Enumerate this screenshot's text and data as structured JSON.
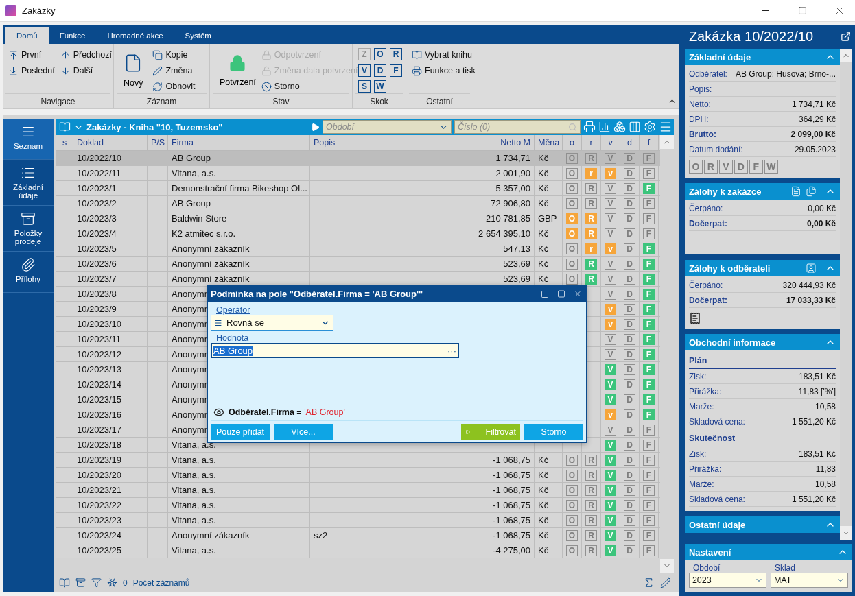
{
  "window": {
    "title": "Zakázky"
  },
  "ribbon": {
    "tabs": [
      {
        "label": "Domů",
        "selected": true
      },
      {
        "label": "Funkce",
        "selected": false
      },
      {
        "label": "Hromadné akce",
        "selected": false
      },
      {
        "label": "Systém",
        "selected": false
      }
    ],
    "navigace": {
      "label": "Navigace",
      "items": [
        {
          "label": "První"
        },
        {
          "label": "Poslední"
        },
        {
          "label": "Předchozí"
        },
        {
          "label": "Další"
        }
      ]
    },
    "zaznam": {
      "label": "Záznam",
      "big": "Nový",
      "items": [
        {
          "label": "Kopie"
        },
        {
          "label": "Změna"
        },
        {
          "label": "Obnovit"
        }
      ]
    },
    "stav": {
      "label": "Stav",
      "big": "Potvrzení",
      "items": [
        {
          "label": "Odpotvrzení",
          "disabled": true
        },
        {
          "label": "Změna data potvrzení",
          "disabled": true
        },
        {
          "label": "Storno",
          "disabled": false
        }
      ]
    },
    "skok": {
      "label": "Skok",
      "keys": [
        {
          "label": "Z",
          "disabled": true
        },
        {
          "label": "O",
          "disabled": false
        },
        {
          "label": "R",
          "disabled": false
        },
        {
          "label": "V",
          "disabled": false
        },
        {
          "label": "D",
          "disabled": false
        },
        {
          "label": "F",
          "disabled": false
        },
        {
          "label": "S",
          "disabled": false
        },
        {
          "label": "W",
          "disabled": false
        }
      ]
    },
    "ostatni": {
      "label": "Ostatní",
      "items": [
        {
          "label": "Vybrat knihu"
        },
        {
          "label": "Funkce a tisk"
        }
      ]
    }
  },
  "nav": [
    {
      "label": "Seznam",
      "selected": true
    },
    {
      "label": "Základní údaje",
      "selected": false
    },
    {
      "label": "Položky prodeje",
      "selected": false
    },
    {
      "label": "Přílohy",
      "selected": false
    }
  ],
  "grid": {
    "title": "Zakázky - Kniha \"10, Tuzemsko\"",
    "period_placeholder": "Období",
    "number_placeholder": "Číslo (0)",
    "columns": [
      "s",
      "Doklad",
      "P/S",
      "Firma",
      "Popis",
      "Netto M",
      "Měna",
      "o",
      "r",
      "v",
      "d",
      "f"
    ],
    "rows": [
      {
        "selected": true,
        "doklad": "10/2022/10",
        "firma": "AB Group",
        "netto": "1 734,71",
        "mena": "Kč",
        "flags": {
          "o": {
            "letter": "O",
            "lit": false
          },
          "r": {
            "letter": "R",
            "lit": false
          },
          "v": {
            "letter": "V",
            "lit": false
          },
          "d": {
            "letter": "D",
            "lit": false
          },
          "f": {
            "letter": "F",
            "lit": false
          }
        }
      },
      {
        "selected": false,
        "doklad": "10/2022/11",
        "firma": "Vitana, a.s.",
        "netto": "2 001,90",
        "mena": "Kč",
        "flags": {
          "o": {
            "letter": "O",
            "lit": false
          },
          "r": {
            "letter": "r",
            "lit": true,
            "color": "#f6a53a"
          },
          "v": {
            "letter": "v",
            "lit": true,
            "color": "#f6a53a"
          },
          "d": {
            "letter": "D",
            "lit": false
          },
          "f": {
            "letter": "F",
            "lit": false
          }
        }
      },
      {
        "selected": false,
        "doklad": "10/2023/1",
        "firma": "Demonstrační firma Bikeshop Ol...",
        "netto": "5 357,00",
        "mena": "Kč",
        "flags": {
          "o": {
            "letter": "O",
            "lit": false
          },
          "r": {
            "letter": "R",
            "lit": false
          },
          "v": {
            "letter": "V",
            "lit": false
          },
          "d": {
            "letter": "D",
            "lit": false
          },
          "f": {
            "letter": "F",
            "lit": true,
            "color": "#3cc47c"
          }
        }
      },
      {
        "selected": false,
        "doklad": "10/2023/2",
        "firma": "AB Group",
        "netto": "72 906,80",
        "mena": "Kč",
        "flags": {
          "o": {
            "letter": "O",
            "lit": false
          },
          "r": {
            "letter": "R",
            "lit": false
          },
          "v": {
            "letter": "V",
            "lit": false
          },
          "d": {
            "letter": "D",
            "lit": false
          },
          "f": {
            "letter": "F",
            "lit": false
          }
        }
      },
      {
        "selected": false,
        "doklad": "10/2023/3",
        "firma": "Baldwin Store",
        "netto": "210 781,85",
        "mena": "GBP",
        "flags": {
          "o": {
            "letter": "O",
            "lit": true,
            "color": "#f6a53a"
          },
          "r": {
            "letter": "R",
            "lit": true,
            "color": "#f6a53a"
          },
          "v": {
            "letter": "V",
            "lit": false
          },
          "d": {
            "letter": "D",
            "lit": false
          },
          "f": {
            "letter": "F",
            "lit": false
          }
        }
      },
      {
        "selected": false,
        "doklad": "10/2023/4",
        "firma": "K2 atmitec s.r.o.",
        "netto": "2 654 395,10",
        "mena": "Kč",
        "flags": {
          "o": {
            "letter": "O",
            "lit": true,
            "color": "#f6a53a"
          },
          "r": {
            "letter": "R",
            "lit": true,
            "color": "#f6a53a"
          },
          "v": {
            "letter": "V",
            "lit": false
          },
          "d": {
            "letter": "D",
            "lit": false
          },
          "f": {
            "letter": "F",
            "lit": false
          }
        }
      },
      {
        "selected": false,
        "doklad": "10/2023/5",
        "firma": "Anonymní zákazník",
        "netto": "547,13",
        "mena": "Kč",
        "flags": {
          "o": {
            "letter": "O",
            "lit": false
          },
          "r": {
            "letter": "r",
            "lit": true,
            "color": "#f6a53a"
          },
          "v": {
            "letter": "v",
            "lit": true,
            "color": "#f6a53a"
          },
          "d": {
            "letter": "D",
            "lit": false
          },
          "f": {
            "letter": "F",
            "lit": true,
            "color": "#3cc47c"
          }
        }
      },
      {
        "selected": false,
        "doklad": "10/2023/6",
        "firma": "Anonymní zákazník",
        "netto": "523,69",
        "mena": "Kč",
        "flags": {
          "o": {
            "letter": "O",
            "lit": false
          },
          "r": {
            "letter": "R",
            "lit": true,
            "color": "#3cc47c"
          },
          "v": {
            "letter": "V",
            "lit": false
          },
          "d": {
            "letter": "D",
            "lit": false
          },
          "f": {
            "letter": "F",
            "lit": true,
            "color": "#3cc47c"
          }
        }
      },
      {
        "selected": false,
        "doklad": "10/2023/7",
        "firma": "Anonymní zákazník",
        "netto": "523,69",
        "mena": "Kč",
        "flags": {
          "o": {
            "letter": "O",
            "lit": false
          },
          "r": {
            "letter": "R",
            "lit": true,
            "color": "#3cc47c"
          },
          "v": {
            "letter": "V",
            "lit": false
          },
          "d": {
            "letter": "D",
            "lit": false
          },
          "f": {
            "letter": "F",
            "lit": true,
            "color": "#3cc47c"
          }
        }
      },
      {
        "selected": false,
        "doklad": "10/2023/8",
        "firma": "Anonymn",
        "flags": {
          "v": {
            "letter": "V",
            "lit": false
          },
          "d": {
            "letter": "D",
            "lit": false
          },
          "f": {
            "letter": "F",
            "lit": true,
            "color": "#3cc47c"
          }
        }
      },
      {
        "selected": false,
        "doklad": "10/2023/9",
        "firma": "Anonymn",
        "flags": {
          "v": {
            "letter": "v",
            "lit": true,
            "color": "#f6a53a"
          },
          "d": {
            "letter": "D",
            "lit": false
          },
          "f": {
            "letter": "F",
            "lit": true,
            "color": "#3cc47c"
          }
        }
      },
      {
        "selected": false,
        "doklad": "10/2023/10",
        "firma": "Anonymn",
        "flags": {
          "v": {
            "letter": "v",
            "lit": true,
            "color": "#f6a53a"
          },
          "d": {
            "letter": "D",
            "lit": false
          },
          "f": {
            "letter": "F",
            "lit": true,
            "color": "#3cc47c"
          }
        }
      },
      {
        "selected": false,
        "doklad": "10/2023/11",
        "firma": "Anonymn",
        "flags": {
          "v": {
            "letter": "V",
            "lit": false
          },
          "d": {
            "letter": "D",
            "lit": false
          },
          "f": {
            "letter": "F",
            "lit": true,
            "color": "#3cc47c"
          }
        }
      },
      {
        "selected": false,
        "doklad": "10/2023/12",
        "firma": "Anonymn",
        "flags": {
          "v": {
            "letter": "V",
            "lit": false
          },
          "d": {
            "letter": "D",
            "lit": false
          },
          "f": {
            "letter": "F",
            "lit": true,
            "color": "#3cc47c"
          }
        }
      },
      {
        "selected": false,
        "doklad": "10/2023/13",
        "firma": "Anonymn",
        "flags": {
          "v": {
            "letter": "V",
            "lit": true,
            "color": "#3cc47c"
          },
          "d": {
            "letter": "D",
            "lit": false
          },
          "f": {
            "letter": "F",
            "lit": true,
            "color": "#3cc47c"
          }
        }
      },
      {
        "selected": false,
        "doklad": "10/2023/14",
        "firma": "Anonymn",
        "flags": {
          "v": {
            "letter": "V",
            "lit": true,
            "color": "#3cc47c"
          },
          "d": {
            "letter": "D",
            "lit": false
          },
          "f": {
            "letter": "F",
            "lit": true,
            "color": "#3cc47c"
          }
        }
      },
      {
        "selected": false,
        "doklad": "10/2023/15",
        "firma": "Anonymn",
        "flags": {
          "v": {
            "letter": "V",
            "lit": true,
            "color": "#3cc47c"
          },
          "d": {
            "letter": "D",
            "lit": false
          },
          "f": {
            "letter": "F",
            "lit": true,
            "color": "#3cc47c"
          }
        }
      },
      {
        "selected": false,
        "doklad": "10/2023/16",
        "firma": "Anonymn",
        "flags": {
          "v": {
            "letter": "v",
            "lit": true,
            "color": "#f6a53a"
          },
          "d": {
            "letter": "D",
            "lit": false
          },
          "f": {
            "letter": "F",
            "lit": true,
            "color": "#3cc47c"
          }
        }
      },
      {
        "selected": false,
        "doklad": "10/2023/17",
        "firma": "Anonymn",
        "flags": {
          "v": {
            "letter": "V",
            "lit": false
          },
          "d": {
            "letter": "D",
            "lit": false
          },
          "f": {
            "letter": "F",
            "lit": false
          }
        }
      },
      {
        "selected": false,
        "doklad": "10/2023/18",
        "firma": "Vitana, a.s.",
        "flags": {
          "v": {
            "letter": "V",
            "lit": true,
            "color": "#3cc47c"
          },
          "d": {
            "letter": "D",
            "lit": false
          },
          "f": {
            "letter": "F",
            "lit": false
          }
        }
      },
      {
        "selected": false,
        "doklad": "10/2023/19",
        "firma": "Vitana, a.s.",
        "netto": "-1 068,75",
        "mena": "Kč",
        "flags": {
          "o": {
            "letter": "O",
            "lit": false
          },
          "r": {
            "letter": "R",
            "lit": false
          },
          "v": {
            "letter": "V",
            "lit": true,
            "color": "#3cc47c"
          },
          "d": {
            "letter": "D",
            "lit": false
          },
          "f": {
            "letter": "F",
            "lit": false
          }
        }
      },
      {
        "selected": false,
        "doklad": "10/2023/20",
        "firma": "Vitana, a.s.",
        "netto": "-1 068,75",
        "mena": "Kč",
        "flags": {
          "o": {
            "letter": "O",
            "lit": false
          },
          "r": {
            "letter": "R",
            "lit": false
          },
          "v": {
            "letter": "V",
            "lit": true,
            "color": "#3cc47c"
          },
          "d": {
            "letter": "D",
            "lit": false
          },
          "f": {
            "letter": "F",
            "lit": false
          }
        }
      },
      {
        "selected": false,
        "doklad": "10/2023/21",
        "firma": "Vitana, a.s.",
        "netto": "-1 068,75",
        "mena": "Kč",
        "flags": {
          "o": {
            "letter": "O",
            "lit": false
          },
          "r": {
            "letter": "R",
            "lit": false
          },
          "v": {
            "letter": "V",
            "lit": true,
            "color": "#3cc47c"
          },
          "d": {
            "letter": "D",
            "lit": false
          },
          "f": {
            "letter": "F",
            "lit": false
          }
        }
      },
      {
        "selected": false,
        "doklad": "10/2023/22",
        "firma": "Vitana, a.s.",
        "netto": "-1 068,75",
        "mena": "Kč",
        "flags": {
          "o": {
            "letter": "O",
            "lit": false
          },
          "r": {
            "letter": "R",
            "lit": false
          },
          "v": {
            "letter": "V",
            "lit": true,
            "color": "#3cc47c"
          },
          "d": {
            "letter": "D",
            "lit": false
          },
          "f": {
            "letter": "F",
            "lit": false
          }
        }
      },
      {
        "selected": false,
        "doklad": "10/2023/23",
        "firma": "Vitana, a.s.",
        "netto": "-1 068,75",
        "mena": "Kč",
        "flags": {
          "o": {
            "letter": "O",
            "lit": false
          },
          "r": {
            "letter": "R",
            "lit": false
          },
          "v": {
            "letter": "V",
            "lit": true,
            "color": "#3cc47c"
          },
          "d": {
            "letter": "D",
            "lit": false
          },
          "f": {
            "letter": "F",
            "lit": false
          }
        }
      },
      {
        "selected": false,
        "doklad": "10/2023/24",
        "firma": "Anonymní zákazník",
        "popis": "sz2",
        "netto": "-1 068,75",
        "mena": "Kč",
        "flags": {
          "o": {
            "letter": "O",
            "lit": false
          },
          "r": {
            "letter": "R",
            "lit": false
          },
          "v": {
            "letter": "V",
            "lit": true,
            "color": "#3cc47c"
          },
          "d": {
            "letter": "D",
            "lit": false
          },
          "f": {
            "letter": "F",
            "lit": false
          }
        }
      },
      {
        "selected": false,
        "doklad": "10/2023/25",
        "firma": "Vitana, a.s.",
        "netto": "-4 275,00",
        "mena": "Kč",
        "flags": {
          "o": {
            "letter": "O",
            "lit": false
          },
          "r": {
            "letter": "R",
            "lit": false
          },
          "v": {
            "letter": "V",
            "lit": true,
            "color": "#3cc47c"
          },
          "d": {
            "letter": "D",
            "lit": false
          },
          "f": {
            "letter": "F",
            "lit": false
          }
        }
      }
    ],
    "status_bar": {
      "count": "0",
      "label": "Počet záznamů"
    }
  },
  "dialog": {
    "title": "Podmínka na pole \"Odběratel.Firma = 'AB Group'\"",
    "operator_label": "Operátor",
    "operator_value": "Rovná se",
    "value_label": "Hodnota",
    "value": "AB Group",
    "browse": "···",
    "condition_field": "Odběratel.Firma",
    "condition_op": "=",
    "condition_value": "'AB Group'",
    "buttons": [
      {
        "label": "Pouze přidat",
        "kind": "plain"
      },
      {
        "label": "Více...",
        "kind": "plain"
      },
      {
        "label": "Filtrovat",
        "kind": "run"
      },
      {
        "label": "Storno",
        "kind": "plain"
      }
    ]
  },
  "detail": {
    "title": "Zakázka 10/2022/10",
    "sections": [
      {
        "title": "Základní údaje",
        "rows": [
          {
            "label": "Odběratel:",
            "value": "AB Group; Husova; Brno-...",
            "bold": false
          },
          {
            "label": "Popis:",
            "bold": false
          },
          {
            "label": "Netto:",
            "value": "1 734,71 Kč",
            "bold": false
          },
          {
            "label": "DPH:",
            "value": "364,29 Kč",
            "bold": false
          },
          {
            "label": "Brutto:",
            "value": "2 099,00 Kč",
            "bold": true
          },
          {
            "label": "Datum dodání:",
            "value": "29.05.2023",
            "bold": false
          }
        ],
        "flags": [
          "O",
          "R",
          "V",
          "D",
          "F",
          "W"
        ]
      },
      {
        "title": "Zálohy k zakázce",
        "rows": [
          {
            "label": "Čerpáno:",
            "value": "0,00 Kč",
            "bold": false
          },
          {
            "label": "Dočerpat:",
            "value": "0,00 Kč",
            "bold": true
          }
        ]
      },
      {
        "title": "Zálohy k odběrateli",
        "rows": [
          {
            "label": "Čerpáno:",
            "value": "320 444,93 Kč",
            "bold": false
          },
          {
            "label": "Dočerpat:",
            "value": "17 033,33 Kč",
            "bold": true
          }
        ]
      },
      {
        "title": "Obchodní informace",
        "groups": [
          {
            "title": "Plán",
            "rows": [
              {
                "label": "Zisk:",
                "value": "183,51 Kč",
                "bold": false
              },
              {
                "label": "Přirážka:",
                "value": "11,83 ['%']",
                "bold": false
              },
              {
                "label": "Marže:",
                "value": "10,58",
                "bold": false
              },
              {
                "label": "Skladová cena:",
                "value": "1 551,20 Kč",
                "bold": false
              }
            ]
          },
          {
            "title": "Skutečnost",
            "rows": [
              {
                "label": "Zisk:",
                "value": "183,51 Kč",
                "bold": false
              },
              {
                "label": "Přirážka:",
                "value": "11,83",
                "bold": false
              },
              {
                "label": "Marže:",
                "value": "10,58",
                "bold": false
              },
              {
                "label": "Skladová cena:",
                "value": "1 551,20 Kč",
                "bold": false
              }
            ]
          }
        ]
      },
      {
        "title": "Ostatní údaje"
      }
    ],
    "settings": {
      "title": "Nastavení",
      "fields": [
        {
          "label": "Období",
          "value": "2023"
        },
        {
          "label": "Sklad",
          "value": "MAT"
        }
      ]
    }
  }
}
